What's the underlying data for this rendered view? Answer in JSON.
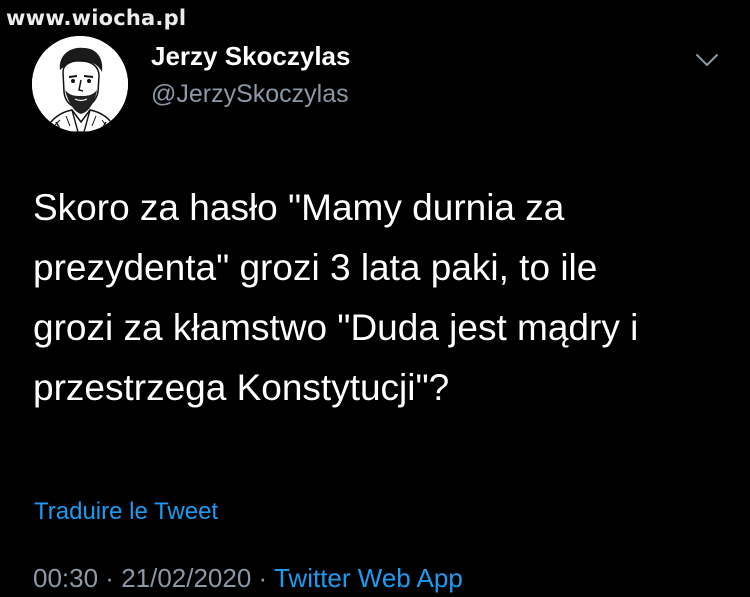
{
  "watermark": "www.wiocha.pl",
  "author": {
    "display_name": "Jerzy Skoczylas",
    "handle": "@JerzySkoczylas",
    "avatar": "portrait-sketch"
  },
  "tweet": {
    "lines": [
      "Skoro za hasło \"Mamy durnia za",
      "prezydenta\" grozi 3 lata paki, to ile",
      "grozi za kłamstwo \"Duda jest mądry i",
      "przestrzega Konstytucji\"?"
    ],
    "translate_label": "Traduire le Tweet",
    "time": "00:30",
    "separator": " · ",
    "date": "21/02/2020",
    "source": "Twitter Web App"
  },
  "icons": {
    "more_menu": "chevron-down-icon"
  },
  "colors": {
    "background": "#000000",
    "text": "#ffffff",
    "secondary": "#8b98a5",
    "link": "#1d9bf0"
  }
}
